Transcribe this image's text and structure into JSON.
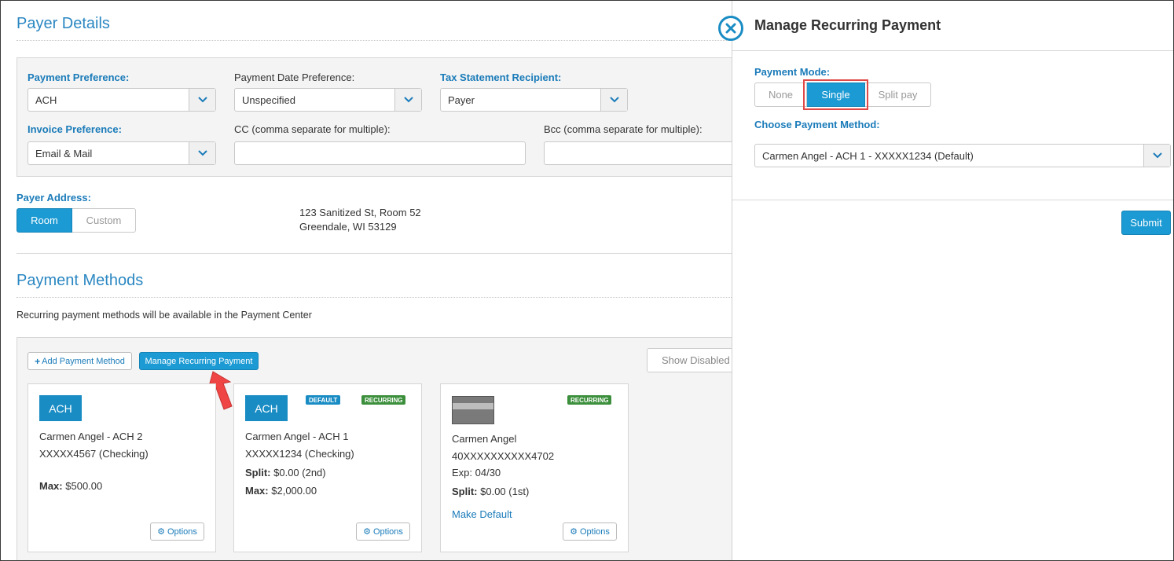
{
  "payer_details": {
    "title": "Payer Details",
    "payment_preference_label": "Payment Preference:",
    "payment_preference_value": "ACH",
    "payment_date_label": "Payment Date Preference:",
    "payment_date_value": "Unspecified",
    "tax_label": "Tax Statement Recipient:",
    "tax_value": "Payer",
    "invoice_label": "Invoice Preference:",
    "invoice_value": "Email & Mail",
    "cc_label": "CC (comma separate for multiple):",
    "bcc_label": "Bcc (comma separate for multiple):",
    "address_label": "Payer Address:",
    "address_tabs": [
      "Room",
      "Custom"
    ],
    "address_line1": "123 Sanitized St, Room 52",
    "address_line2": "Greendale, WI 53129"
  },
  "payment_methods": {
    "title": "Payment Methods",
    "note": "Recurring payment methods will be available in the Payment Center",
    "add_label": "Add Payment Method",
    "manage_label": "Manage Recurring Payment",
    "show_disabled_label": "Show Disabled",
    "options_label": "Options",
    "cards": [
      {
        "type": "ACH",
        "name": "Carmen Angel - ACH 2",
        "account": "XXXXX4567 (Checking)",
        "max_label": "Max:",
        "max_value": "$500.00"
      },
      {
        "type": "ACH",
        "default_tag": "DEFAULT",
        "recurring_tag": "RECURRING",
        "name": "Carmen Angel - ACH 1",
        "account": "XXXXX1234 (Checking)",
        "split_label": "Split:",
        "split_value": "$0.00 (2nd)",
        "max_label": "Max:",
        "max_value": "$2,000.00"
      },
      {
        "recurring_tag": "RECURRING",
        "name": "Carmen Angel",
        "account": "40XXXXXXXXXX4702",
        "exp": "Exp: 04/30",
        "split_label": "Split:",
        "split_value": "$0.00 (1st)",
        "make_default": "Make Default"
      }
    ]
  },
  "panel": {
    "title": "Manage Recurring Payment",
    "mode_label": "Payment Mode:",
    "modes": [
      "None",
      "Single",
      "Split pay"
    ],
    "selected_mode": "Single",
    "method_label": "Choose Payment Method:",
    "method_value": "Carmen Angel - ACH 1 - XXXXX1234 (Default)",
    "submit_label": "Submit"
  },
  "colors": {
    "accent": "#1c9ad3",
    "heading": "#2a87c2",
    "highlight": "#e04848",
    "recurring": "#3c8f3c"
  }
}
